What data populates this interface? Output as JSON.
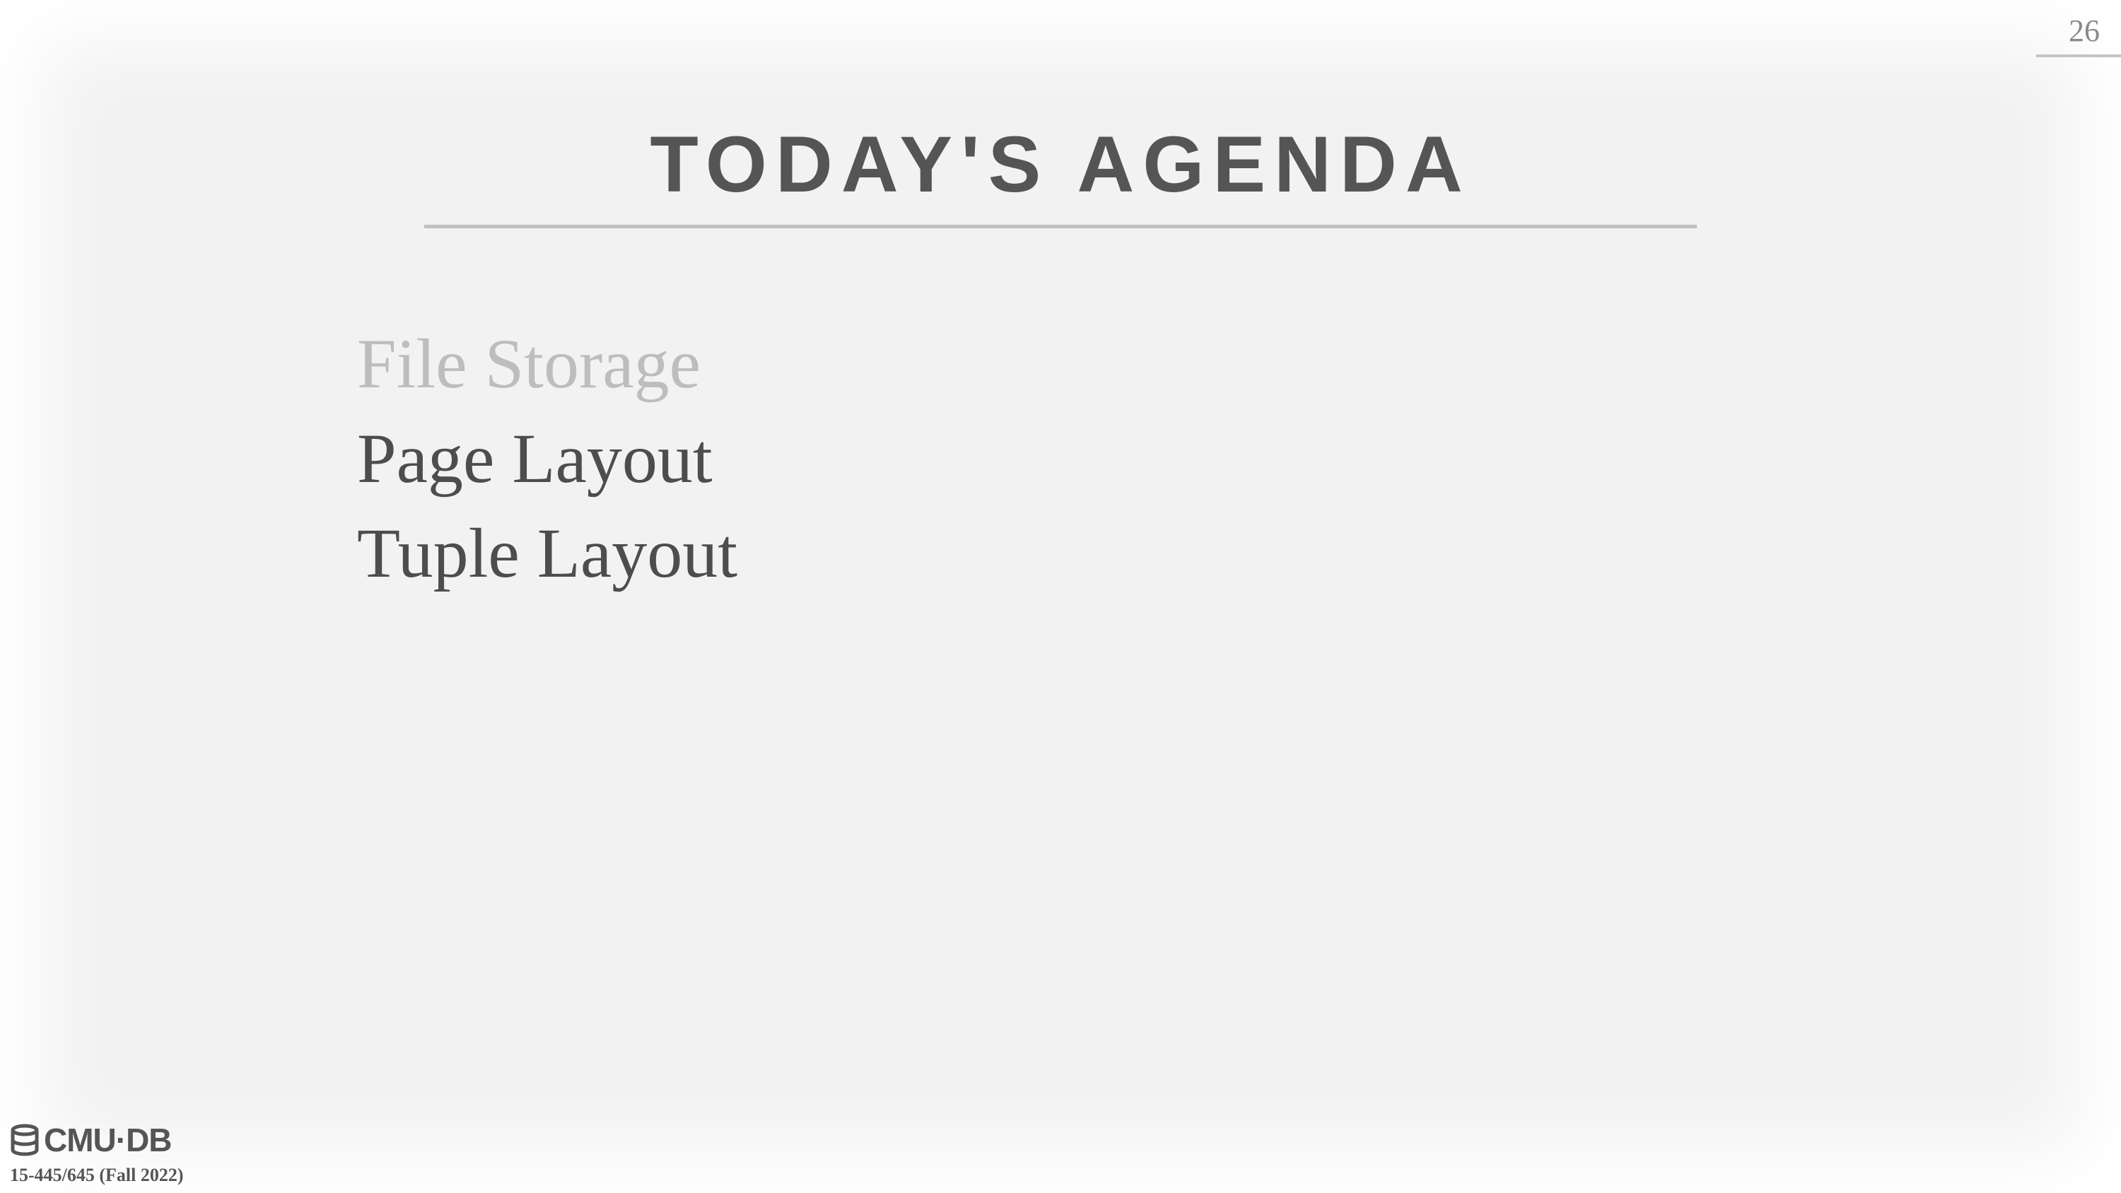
{
  "slide": {
    "page_number": "26",
    "title": "TODAY'S AGENDA",
    "agenda": [
      {
        "label": "File Storage",
        "state": "dimmed"
      },
      {
        "label": "Page Layout",
        "state": "active"
      },
      {
        "label": "Tuple Layout",
        "state": "active"
      }
    ]
  },
  "footer": {
    "logo_text": "CMU·DB",
    "logo_icon": "database-icon",
    "course": "15-445/645 (Fall 2022)"
  },
  "colors": {
    "background": "#f2f2f2",
    "text": "#555555",
    "dimmed_text": "#bdbdbd",
    "rule": "#c0c0c0"
  }
}
